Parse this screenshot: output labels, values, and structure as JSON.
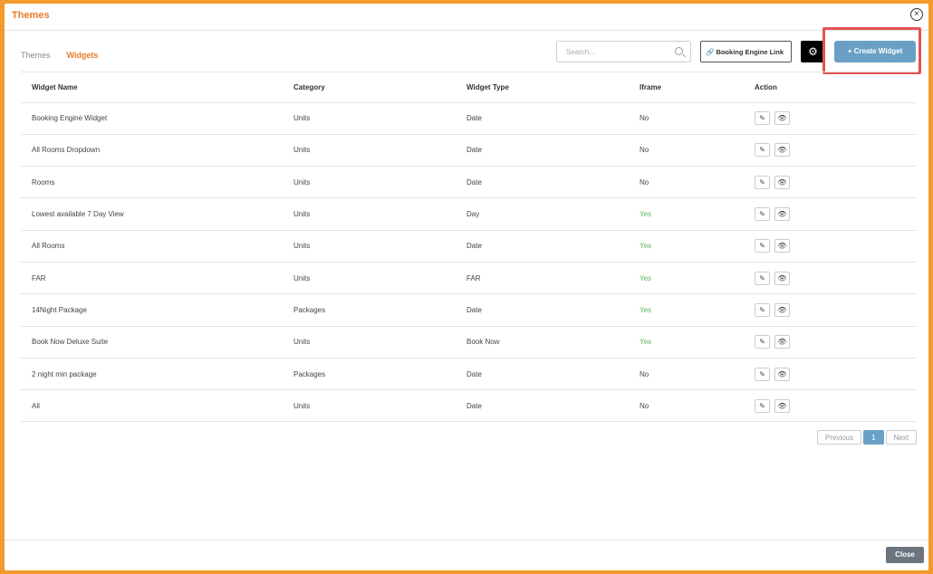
{
  "modal": {
    "title": "Themes",
    "close_icon": "close-circle-icon"
  },
  "tabs": [
    {
      "label": "Themes"
    },
    {
      "label": "Widgets",
      "active": true
    }
  ],
  "toolbar": {
    "search_placeholder": "Search...",
    "booking_engine_link": "Booking Engine Link",
    "create_widget": "Create Widget"
  },
  "table": {
    "headers": [
      "Widget Name",
      "Category",
      "Widget Type",
      "Iframe",
      "Action"
    ],
    "rows": [
      [
        "Booking Engine Widget",
        "Units",
        "Date",
        "No"
      ],
      [
        "All Rooms Dropdown",
        "Units",
        "Date",
        "No"
      ],
      [
        "Rooms",
        "Units",
        "Date",
        "No"
      ],
      [
        "Lowest available 7 Day View",
        "Units",
        "Day",
        "Yes"
      ],
      [
        "All Rooms",
        "Units",
        "Date",
        "Yes"
      ],
      [
        "FAR",
        "Units",
        "FAR",
        "Yes"
      ],
      [
        "14Night Package",
        "Packages",
        "Date",
        "Yes"
      ],
      [
        "Book Now Deluxe Suite",
        "Units",
        "Book Now",
        "Yes"
      ],
      [
        "2 night min package",
        "Packages",
        "Date",
        "No"
      ],
      [
        "All",
        "Units",
        "Date",
        "No"
      ]
    ]
  },
  "pagination": {
    "previous": "Previous",
    "page": "1",
    "next": "Next"
  },
  "footer": {
    "close": "Close"
  },
  "colors": {
    "accent": "#e8792b",
    "primary": "#6aa0c5",
    "yes": "#5cb85c"
  }
}
